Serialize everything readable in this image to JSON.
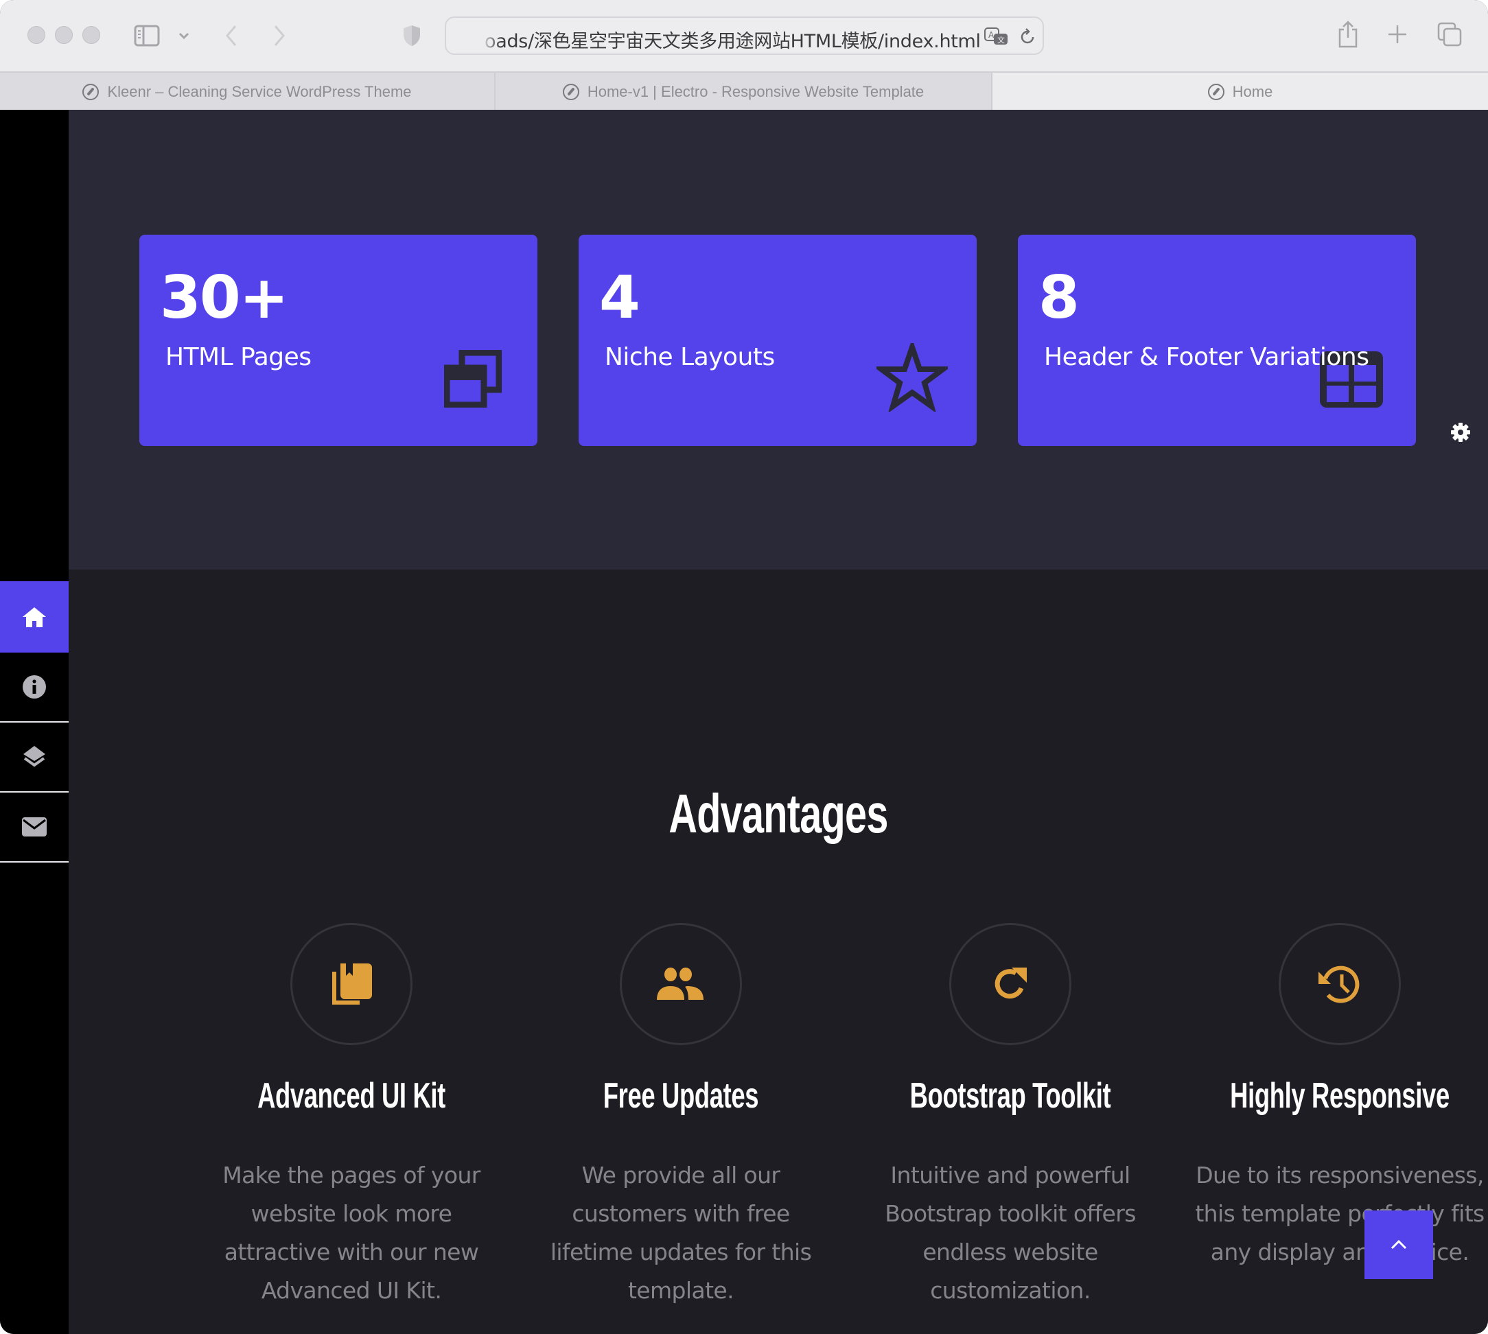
{
  "browser": {
    "url": "oads/深色星空宇宙天文类多用途网站HTML模板/index.html",
    "tabs": [
      {
        "label": "Kleenr – Cleaning Service WordPress Theme",
        "active": false
      },
      {
        "label": "Home-v1 | Electro - Responsive Website Template",
        "active": false
      },
      {
        "label": "Home",
        "active": true
      }
    ],
    "icons": {
      "sidebar_toggle": "sidebar-icon",
      "back": "chevron-left-icon",
      "forward": "chevron-right-icon",
      "privacy": "shield-icon",
      "translate": "translate-icon",
      "reload": "reload-icon",
      "share": "share-icon",
      "new_tab": "plus-icon",
      "tab_overview": "tabs-icon"
    }
  },
  "sidebar": {
    "items": [
      {
        "name": "home",
        "icon": "home-icon",
        "active": true
      },
      {
        "name": "about",
        "icon": "info-icon",
        "active": false
      },
      {
        "name": "services",
        "icon": "layers-icon",
        "active": false
      },
      {
        "name": "contact",
        "icon": "mail-icon",
        "active": false
      }
    ]
  },
  "stats": {
    "cards": [
      {
        "number": "30+",
        "label": "HTML Pages",
        "icon": "copy-icon"
      },
      {
        "number": "4",
        "label": "Niche Layouts",
        "icon": "star-icon"
      },
      {
        "number": "8",
        "label": "Header & Footer Variations",
        "icon": "table-icon"
      }
    ]
  },
  "settings": {
    "icon": "gear-icon"
  },
  "advantages": {
    "title": "Advantages",
    "features": [
      {
        "title": "Advanced UI Kit",
        "icon": "book-icon",
        "text": "Make the pages of your website look more attractive with our new Advanced UI Kit."
      },
      {
        "title": "Free Updates",
        "icon": "users-icon",
        "text": "We provide all our customers with free lifetime updates for this template."
      },
      {
        "title": "Bootstrap Toolkit",
        "icon": "refresh-icon",
        "text": "Intuitive and powerful Bootstrap toolkit offers endless website customization."
      },
      {
        "title": "Highly Responsive",
        "icon": "history-icon",
        "text": "Due to its responsiveness, this template perfectly fits any display and device."
      }
    ]
  },
  "scroll_top": {
    "icon": "chevron-up-icon"
  },
  "colors": {
    "accent": "#5443ea",
    "icon_gold": "#e0a03c",
    "stats_bg": "#2a2938",
    "section_bg": "#1e1d23",
    "sidebar_bg": "#000000"
  }
}
